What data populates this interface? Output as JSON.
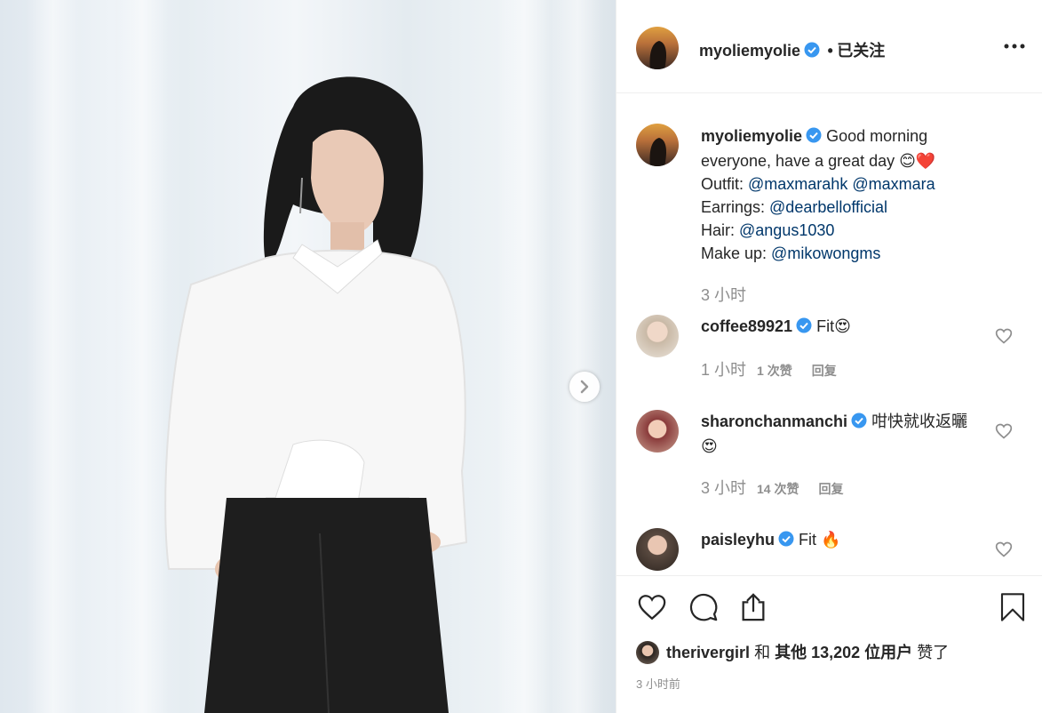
{
  "post": {
    "username": "myoliemyolie",
    "follow_separator": "•",
    "follow_status": "已关注",
    "caption_intro": "Good morning everyone, have a great day",
    "caption_emoji": "😊❤️",
    "caption_lines": [
      {
        "label": "Outfit: ",
        "mentions": [
          "@maxmarahk",
          "@maxmara"
        ]
      },
      {
        "label": "Earrings: ",
        "mentions": [
          "@dearbellofficial"
        ]
      },
      {
        "label": "Hair: ",
        "mentions": [
          "@angus1030"
        ]
      },
      {
        "label": "Make up: ",
        "mentions": [
          "@mikowongms"
        ]
      }
    ],
    "caption_time": "3 小时"
  },
  "comments": [
    {
      "username": "coffee89921",
      "text": "Fit😍",
      "time": "1 小时",
      "likes": "1 次赞",
      "reply": "回复",
      "avatar_color": "#c9b9a6"
    },
    {
      "username": "sharonchanmanchi",
      "text": "咁快就收返曬😍",
      "time": "3 小时",
      "likes": "14 次赞",
      "reply": "回复",
      "avatar_color": "#8a3b3b"
    },
    {
      "username": "paisleyhu",
      "text": "Fit 🔥",
      "time": "",
      "likes": "",
      "reply": "",
      "avatar_color": "#5a4a40"
    }
  ],
  "likes": {
    "first_user": "theriverg­irl",
    "connector": "和",
    "others_prefix": "其他",
    "count": "13,202",
    "others_suffix": "位用户",
    "verb": "赞了"
  },
  "posted": "3 小时前",
  "colors": {
    "verified": "#3897f0",
    "mention": "#00376b",
    "muted": "#8e8e8e"
  },
  "icons": [
    "more-options-icon",
    "verified-icon",
    "heart-icon",
    "comment-icon",
    "share-icon",
    "bookmark-icon",
    "next-arrow-icon"
  ]
}
